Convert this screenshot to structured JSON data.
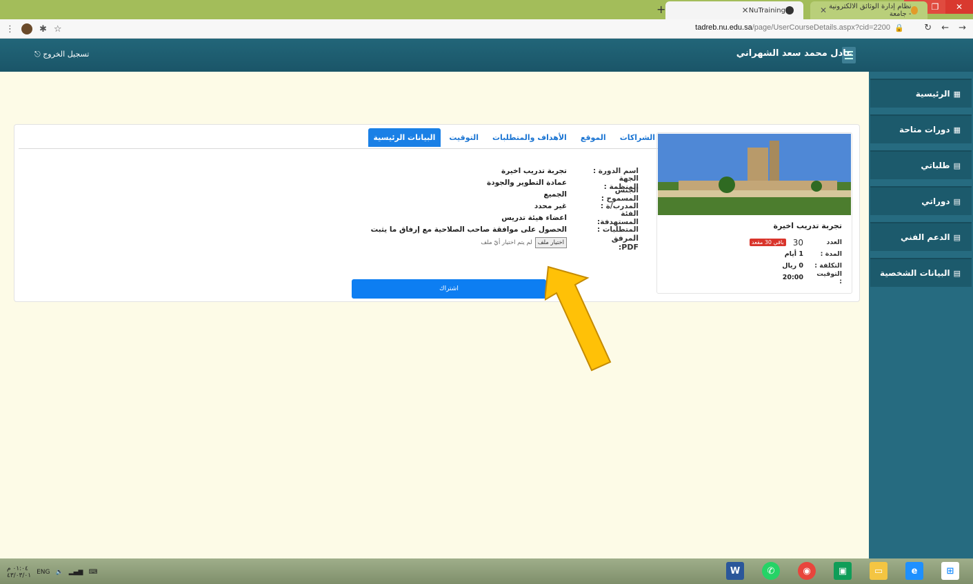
{
  "browser": {
    "tabs": [
      {
        "title": "NuTraining"
      },
      {
        "title": "نظام إدارة الوثائق الالكترونية - جامعة"
      }
    ],
    "url_domain": "tadreb.nu.edu.sa",
    "url_path": "/page/UserCourseDetails.aspx?cid=2200"
  },
  "header": {
    "username": "عادل محمد سعد الشهراني",
    "logout": "تسجيل الخروج"
  },
  "sidebar": {
    "items": [
      {
        "label": "الرئيسية"
      },
      {
        "label": "دورات متاحة"
      },
      {
        "label": "طلباتي"
      },
      {
        "label": "دوراتي"
      },
      {
        "label": "الدعم الفني"
      },
      {
        "label": "البيانات الشخصية"
      }
    ]
  },
  "tabs": [
    {
      "label": "البيانات الرئيسية",
      "active": true
    },
    {
      "label": "التوقيت"
    },
    {
      "label": "الأهداف والمتطلبات"
    },
    {
      "label": "الموقع"
    },
    {
      "label": "الشراكات"
    }
  ],
  "details": [
    {
      "label": "اسم الدورة :",
      "value": "تجربة تدريب اخيرة"
    },
    {
      "label": "الجهة المنظمة :",
      "value": "عمادة التطوير والجودة"
    },
    {
      "label": "الجنس المسموح :",
      "value": "الجميع"
    },
    {
      "label": "المدرب/ة :",
      "value": "غير محدد"
    },
    {
      "label": "الفئة المستهدفة:",
      "value": "اعضاء هيئة تدريس"
    },
    {
      "label": "المتطلبات :",
      "value": "الحصول على موافقة صاحب الصلاحية مع إرفاق ما يثبت"
    }
  ],
  "attachment": {
    "label": "المرفق PDF:",
    "button": "اختيار ملف",
    "status": "لم يتم اختيار أيّ ملف"
  },
  "subscribe_button": "اشتراك",
  "course_card": {
    "title": "تجربة تدريب اخيرة",
    "count_label": "العدد",
    "count": "30",
    "remaining_badge": "باقي 30 مقعد",
    "duration_label": "المدة :",
    "duration": "1 أيام",
    "cost_label": "التكلفة :",
    "cost": "0 ريال",
    "time_label": "التوقيت :",
    "time": "20:00"
  },
  "taskbar": {
    "lang": "ENG",
    "time": "٠١:٠٤ م",
    "date": "٤٣/٠٣/٠١"
  },
  "colors": {
    "header": "#1f5f72",
    "sidebar": "#266b80",
    "active_tab": "#1a80e6",
    "subscribe": "#0d7ef2",
    "badge": "#d9342b",
    "arrow": "#ffc107"
  }
}
